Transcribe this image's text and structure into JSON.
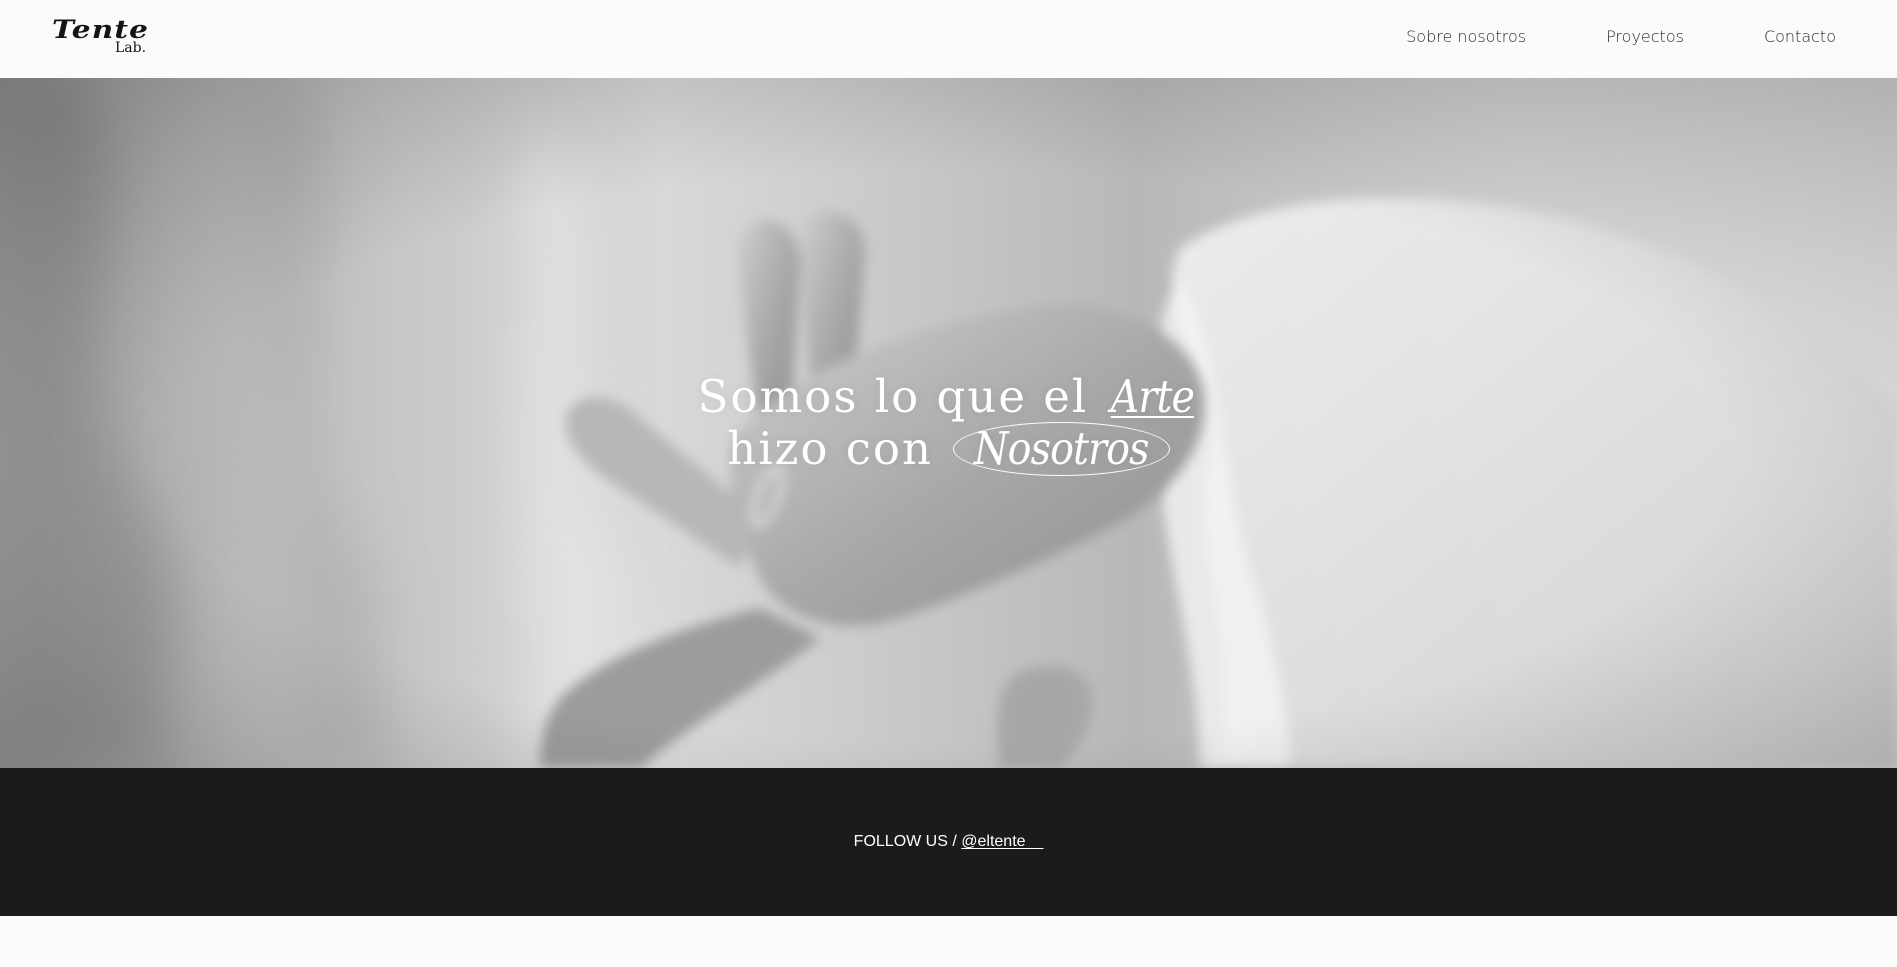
{
  "header": {
    "logo_word": "Tente",
    "logo_sub": "Lab.",
    "nav": [
      {
        "label": "Sobre nosotros"
      },
      {
        "label": "Proyectos"
      },
      {
        "label": "Contacto"
      }
    ]
  },
  "hero": {
    "line1_text": "Somos lo que el ",
    "line1_accent": "Arte",
    "line2_text": "hizo con ",
    "line2_accent": "Nosotros"
  },
  "follow": {
    "label": "FOLLOW US / ",
    "handle": "@eltente__"
  },
  "colors": {
    "header_bg": "#fbfbfb",
    "hero_tone": "#bdbdbd",
    "band_bg": "#1b1b1a",
    "text_light": "#ffffff",
    "text_dark": "#2a2a2a"
  }
}
